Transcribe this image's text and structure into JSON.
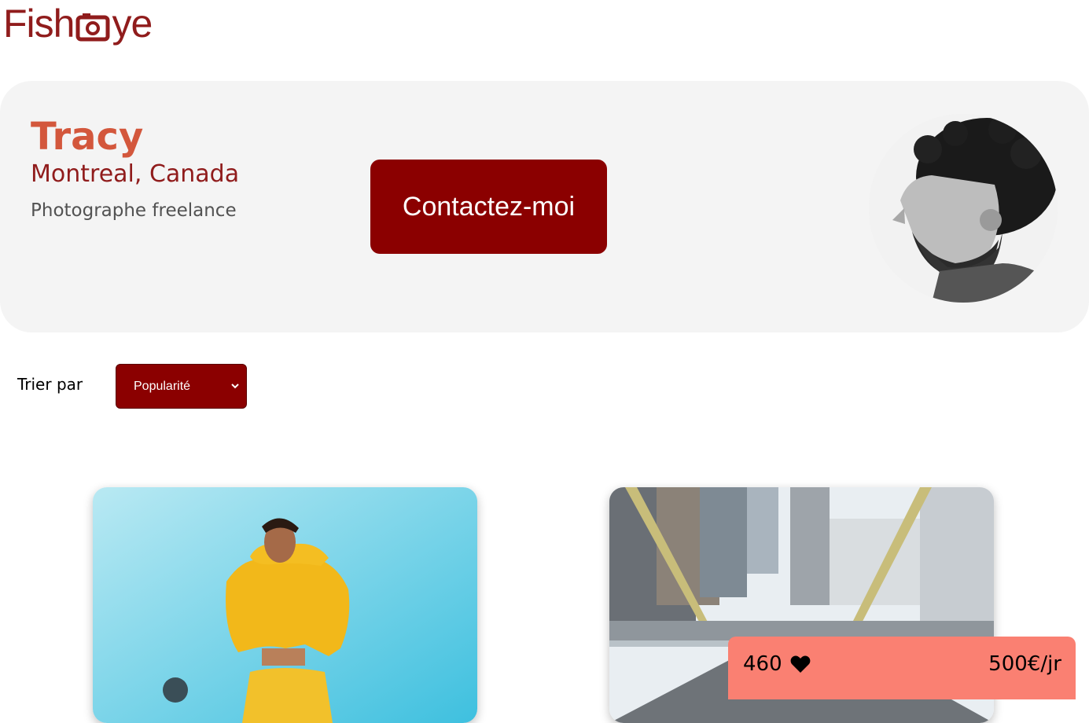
{
  "logo": {
    "text_before": "Fish",
    "text_after": "ye"
  },
  "photographer": {
    "name": "Tracy",
    "location": "Montreal, Canada",
    "tagline": "Photographe freelance"
  },
  "contact_button": {
    "label": "Contactez-moi"
  },
  "sort": {
    "label": "Trier par",
    "selected": "Popularité"
  },
  "stats": {
    "likes": "460",
    "price": "500€/jr"
  },
  "icons": {
    "heart": "heart-icon",
    "chevron": "chevron-down-icon",
    "logo_camera": "camera-icon"
  },
  "colors": {
    "primary": "#901C1C",
    "name": "#D3573C",
    "button": "#8B0000",
    "info_box": "#FA8072"
  }
}
